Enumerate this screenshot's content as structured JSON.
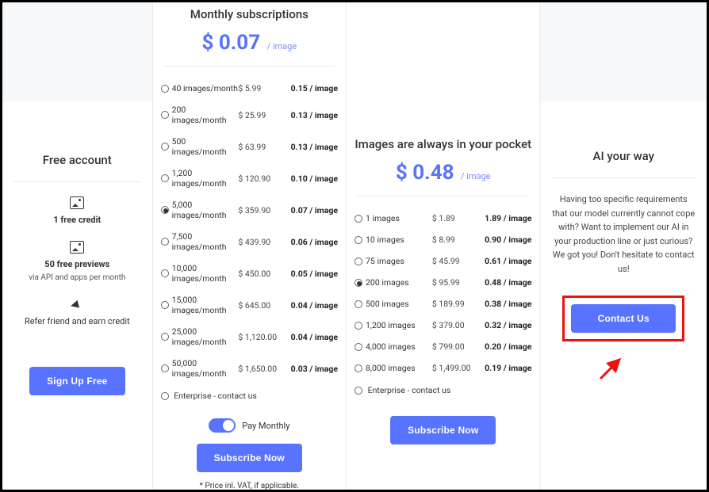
{
  "free": {
    "title": "Free account",
    "credit_label": "1 free credit",
    "previews_label": "50 free previews",
    "previews_sub": "via API and apps per month",
    "refer_label": "Refer friend and earn credit",
    "signup_btn": "Sign Up Free"
  },
  "monthly": {
    "title": "Monthly subscriptions",
    "price": "$ 0.07",
    "per": "/ image",
    "tiers": [
      {
        "label": "40 images/month",
        "price": "$ 5.99",
        "rate": "0.15 / image",
        "selected": false
      },
      {
        "label": "200 images/month",
        "price": "$ 25.99",
        "rate": "0.13 / image",
        "selected": false
      },
      {
        "label": "500 images/month",
        "price": "$ 63.99",
        "rate": "0.13 / image",
        "selected": false
      },
      {
        "label": "1,200 images/month",
        "price": "$ 120.90",
        "rate": "0.10 / image",
        "selected": false
      },
      {
        "label": "5,000 images/month",
        "price": "$ 359.90",
        "rate": "0.07 / image",
        "selected": true
      },
      {
        "label": "7,500 images/month",
        "price": "$ 439.90",
        "rate": "0.06 / image",
        "selected": false
      },
      {
        "label": "10,000 images/month",
        "price": "$ 450.00",
        "rate": "0.05 / image",
        "selected": false
      },
      {
        "label": "15,000 images/month",
        "price": "$ 645.00",
        "rate": "0.04 / image",
        "selected": false
      },
      {
        "label": "25,000 images/month",
        "price": "$ 1,120.00",
        "rate": "0.04 / image",
        "selected": false
      },
      {
        "label": "50,000 images/month",
        "price": "$ 1,650.00",
        "rate": "0.03 / image",
        "selected": false
      }
    ],
    "enterprise": "Enterprise - contact us",
    "toggle_label": "Pay Monthly",
    "subscribe_btn": "Subscribe Now",
    "footnote": "* Price inl. VAT, if applicable."
  },
  "pocket": {
    "title": "Images are always in your pocket",
    "price": "$ 0.48",
    "per": "/ image",
    "tiers": [
      {
        "label": "1 images",
        "price": "$ 1.89",
        "rate": "1.89 / image",
        "selected": false
      },
      {
        "label": "10 images",
        "price": "$ 8.99",
        "rate": "0.90 / image",
        "selected": false
      },
      {
        "label": "75 images",
        "price": "$ 45.99",
        "rate": "0.61 / image",
        "selected": false
      },
      {
        "label": "200 images",
        "price": "$ 95.99",
        "rate": "0.48 / image",
        "selected": true
      },
      {
        "label": "500 images",
        "price": "$ 189.99",
        "rate": "0.38 / image",
        "selected": false
      },
      {
        "label": "1,200 images",
        "price": "$ 379.00",
        "rate": "0.32 / image",
        "selected": false
      },
      {
        "label": "4,000 images",
        "price": "$ 799.00",
        "rate": "0.20 / image",
        "selected": false
      },
      {
        "label": "8,000 images",
        "price": "$ 1,499.00",
        "rate": "0.19 / image",
        "selected": false
      }
    ],
    "enterprise": "Enterprise - contact us",
    "subscribe_btn": "Subscribe Now"
  },
  "ai": {
    "title": "AI your way",
    "body": "Having too specific requirements that our model currently cannot cope with? Want to implement our AI in your production line or just curious? We got you! Don't hesitate to contact us!",
    "contact_btn": "Contact Us"
  }
}
